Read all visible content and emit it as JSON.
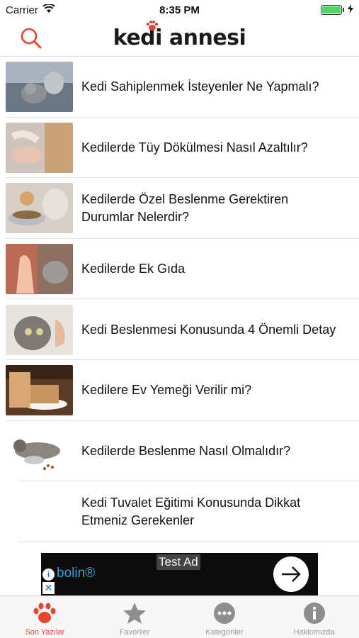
{
  "status_bar": {
    "carrier": "Carrier",
    "time": "8:35 PM"
  },
  "header": {
    "logo": "kedi annesi",
    "search_icon": "search-icon",
    "accent": "#e8432f"
  },
  "articles": [
    {
      "title": "Kedi Sahiplenmek İsteyenler Ne Yapmalı?"
    },
    {
      "title": "Kedilerde Tüy Dökülmesi Nasıl Azaltılır?"
    },
    {
      "title": "Kedilerde Özel Beslenme Gerektiren Durumlar Nelerdir?"
    },
    {
      "title": "Kedilerde Ek Gıda"
    },
    {
      "title": "Kedi Beslenmesi Konusunda 4 Önemli Detay"
    },
    {
      "title": "Kedilere Ev Yemeği Verilir mi?"
    },
    {
      "title": "Kedilerde Beslenme Nasıl Olmalıdır?"
    },
    {
      "title": "Kedi Tuvalet Eğitimi Konusunda Dikkat Etmeniz Gerekenler"
    }
  ],
  "ad": {
    "label": "Test Ad",
    "text": "bolin®"
  },
  "tabs": [
    {
      "label": "Son Yazılar",
      "icon": "paw-icon",
      "active": true
    },
    {
      "label": "Favoriler",
      "icon": "star-icon",
      "active": false
    },
    {
      "label": "Kategoriler",
      "icon": "more-icon",
      "active": false
    },
    {
      "label": "Hakkımızda",
      "icon": "info-icon",
      "active": false
    }
  ]
}
